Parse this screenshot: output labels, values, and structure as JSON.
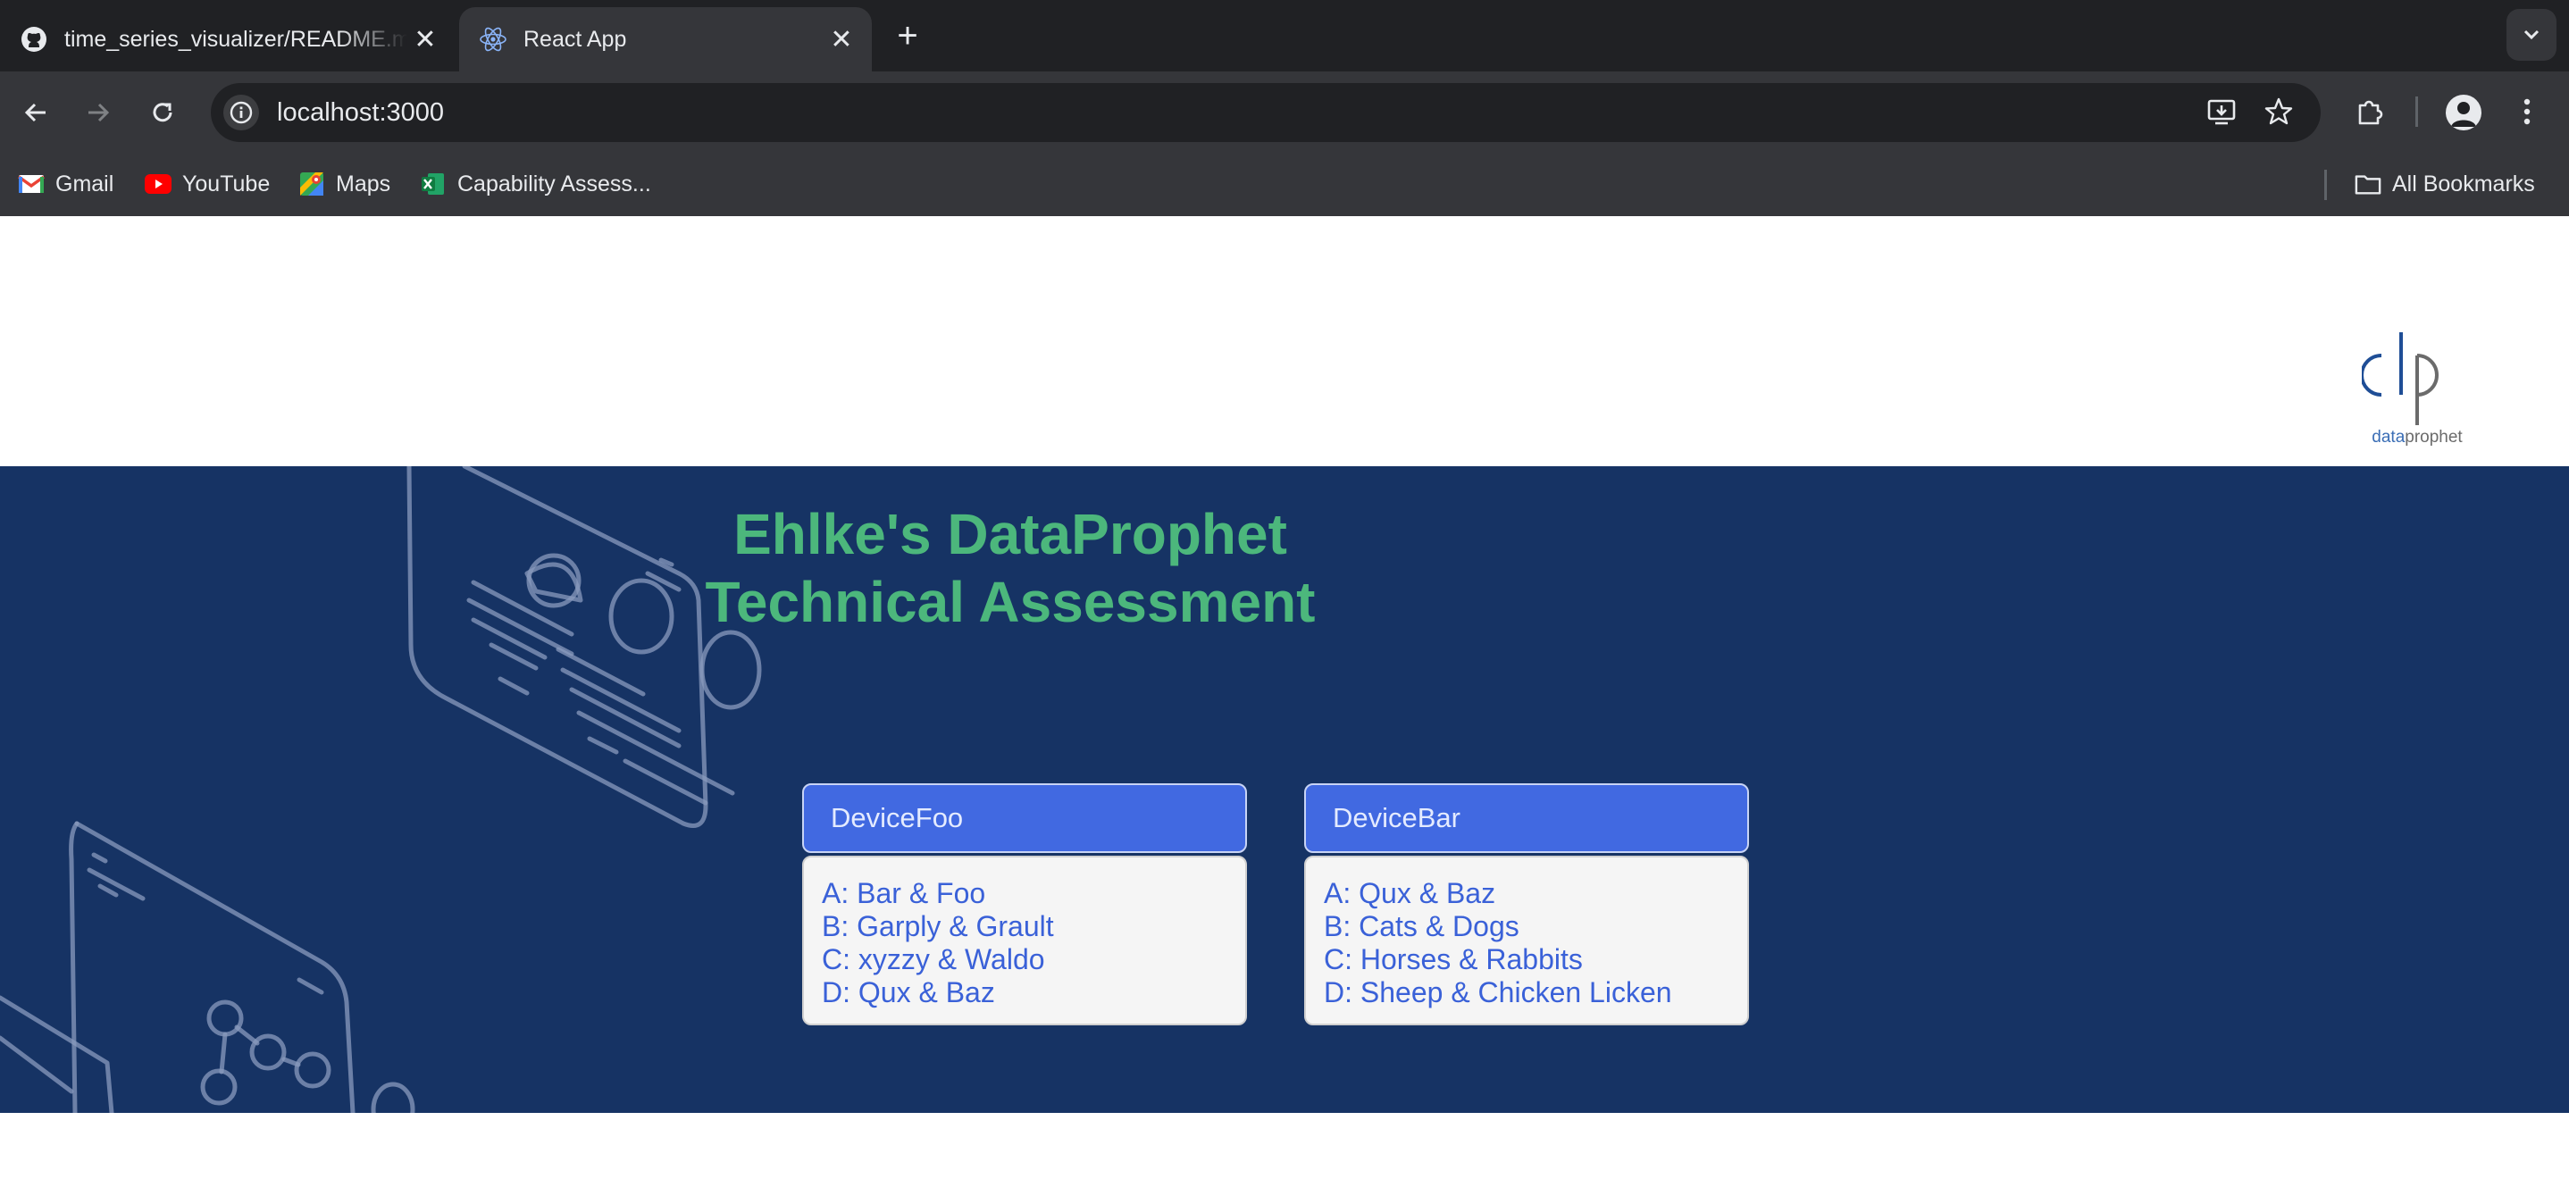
{
  "browser": {
    "tabs": [
      {
        "title": "time_series_visualizer/README.md",
        "icon": "github-icon",
        "active": false
      },
      {
        "title": "React App",
        "icon": "react-icon",
        "active": true
      }
    ],
    "url": "localhost:3000",
    "bookmarks": [
      {
        "label": "Gmail",
        "icon": "gmail-icon"
      },
      {
        "label": "YouTube",
        "icon": "youtube-icon"
      },
      {
        "label": "Maps",
        "icon": "maps-icon"
      },
      {
        "label": "Capability Assess...",
        "icon": "excel-icon"
      }
    ],
    "all_bookmarks_label": "All Bookmarks"
  },
  "page": {
    "logo_text_data": "data",
    "logo_text_prophet": "prophet",
    "title_line1": "Ehlke's DataProphet",
    "title_line2": "Technical Assessment",
    "devices": [
      {
        "name": "DeviceFoo",
        "items": [
          "A: Bar & Foo",
          "B: Garply & Grault",
          "C: xyzzy & Waldo",
          "D: Qux & Baz"
        ]
      },
      {
        "name": "DeviceBar",
        "items": [
          "A: Qux & Baz",
          "B: Cats & Dogs",
          "C: Horses & Rabbits",
          "D: Sheep & Chicken Licken"
        ]
      }
    ]
  },
  "colors": {
    "hero_bg": "#163364",
    "title_green": "#4cb77c",
    "device_button": "#4169e1",
    "list_text": "#3a61d8"
  }
}
